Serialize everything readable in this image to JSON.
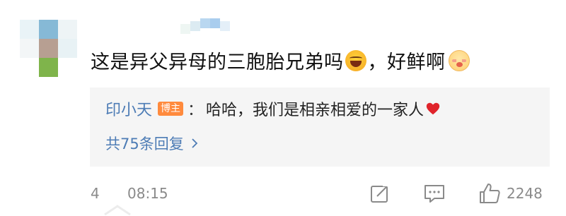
{
  "comment": {
    "text_part1": "这是异父异母的三胞胎兄弟吗",
    "emoji_1": "laugh-emoji",
    "text_part2": "，好鲜啊",
    "emoji_2": "shy-emoji"
  },
  "reply": {
    "author": "印小天",
    "badge": "博主",
    "colon": "：",
    "text": "哈哈，我们是相亲相爱的一家人",
    "icon": "heart-icon",
    "heart_color": "#e0242b"
  },
  "more_replies": {
    "label": "共75条回复",
    "icon": "chevron-right-icon"
  },
  "footer": {
    "floor": "4",
    "time": "08:15",
    "share_icon": "share-icon",
    "comment_icon": "comment-icon",
    "like_icon": "thumbs-up-icon",
    "like_count": "2248"
  },
  "colors": {
    "link_blue": "#4d7cb5",
    "badge_orange": "#ff8a3d",
    "muted_gray": "#8a8a8a",
    "reply_bg": "#f5f5f5"
  }
}
